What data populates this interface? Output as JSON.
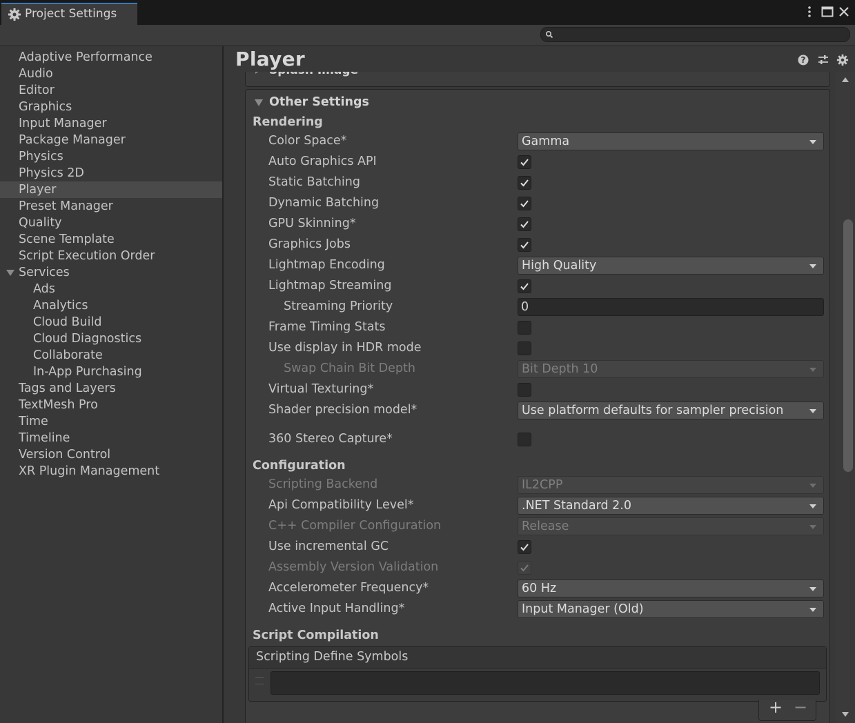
{
  "window": {
    "tab_title": "Project Settings",
    "search_placeholder": ""
  },
  "sidebar": {
    "items": [
      {
        "label": "Adaptive Performance"
      },
      {
        "label": "Audio"
      },
      {
        "label": "Editor"
      },
      {
        "label": "Graphics"
      },
      {
        "label": "Input Manager"
      },
      {
        "label": "Package Manager"
      },
      {
        "label": "Physics"
      },
      {
        "label": "Physics 2D"
      },
      {
        "label": "Player",
        "selected": true
      },
      {
        "label": "Preset Manager"
      },
      {
        "label": "Quality"
      },
      {
        "label": "Scene Template"
      },
      {
        "label": "Script Execution Order"
      },
      {
        "label": "Services",
        "expanded": true
      },
      {
        "label": "Ads",
        "child": true
      },
      {
        "label": "Analytics",
        "child": true
      },
      {
        "label": "Cloud Build",
        "child": true
      },
      {
        "label": "Cloud Diagnostics",
        "child": true
      },
      {
        "label": "Collaborate",
        "child": true
      },
      {
        "label": "In-App Purchasing",
        "child": true
      },
      {
        "label": "Tags and Layers"
      },
      {
        "label": "TextMesh Pro"
      },
      {
        "label": "Time"
      },
      {
        "label": "Timeline"
      },
      {
        "label": "Version Control"
      },
      {
        "label": "XR Plugin Management"
      }
    ]
  },
  "main": {
    "title": "Player",
    "splash_section": "Splash Image",
    "other_section": "Other Settings",
    "groups": {
      "rendering": "Rendering",
      "configuration": "Configuration",
      "script_compilation": "Script Compilation"
    },
    "rendering": {
      "color_space": {
        "label": "Color Space*",
        "value": "Gamma"
      },
      "auto_graphics_api": {
        "label": "Auto Graphics API",
        "checked": true
      },
      "static_batching": {
        "label": "Static Batching",
        "checked": true
      },
      "dynamic_batching": {
        "label": "Dynamic Batching",
        "checked": true
      },
      "gpu_skinning": {
        "label": "GPU Skinning*",
        "checked": true
      },
      "graphics_jobs": {
        "label": "Graphics Jobs",
        "checked": true
      },
      "lightmap_encoding": {
        "label": "Lightmap Encoding",
        "value": "High Quality"
      },
      "lightmap_streaming": {
        "label": "Lightmap Streaming",
        "checked": true
      },
      "streaming_priority": {
        "label": "Streaming Priority",
        "value": "0"
      },
      "frame_timing_stats": {
        "label": "Frame Timing Stats",
        "checked": false
      },
      "hdr_mode": {
        "label": "Use display in HDR mode",
        "checked": false
      },
      "swap_chain_bit_depth": {
        "label": "Swap Chain Bit Depth",
        "value": "Bit Depth 10",
        "disabled": true
      },
      "virtual_texturing": {
        "label": "Virtual Texturing*",
        "checked": false
      },
      "shader_precision": {
        "label": "Shader precision model*",
        "value": "Use platform defaults for sampler precision"
      },
      "stereo_capture": {
        "label": "360 Stereo Capture*",
        "checked": false
      }
    },
    "configuration": {
      "scripting_backend": {
        "label": "Scripting Backend",
        "value": "IL2CPP",
        "disabled": true
      },
      "api_compat": {
        "label": "Api Compatibility Level*",
        "value": ".NET Standard 2.0"
      },
      "cpp_compiler": {
        "label": "C++ Compiler Configuration",
        "value": "Release",
        "disabled": true
      },
      "incremental_gc": {
        "label": "Use incremental GC",
        "checked": true
      },
      "assembly_validation": {
        "label": "Assembly Version Validation",
        "checked": true,
        "disabled": true
      },
      "accelerometer": {
        "label": "Accelerometer Frequency*",
        "value": "60 Hz"
      },
      "input_handling": {
        "label": "Active Input Handling*",
        "value": "Input Manager (Old)"
      }
    },
    "script_compilation": {
      "define_symbols_header": "Scripting Define Symbols",
      "define_symbols_value": "",
      "add_label": "+",
      "remove_label": "−"
    }
  },
  "icons": {
    "tab": "gear-icon",
    "header": [
      "help-icon",
      "presets-icon",
      "settings-icon"
    ],
    "window": [
      "more-icon",
      "maximize-icon",
      "close-icon"
    ]
  },
  "colors": {
    "background": "#383838",
    "titlebar": "#191919",
    "selection": "#4a4a4a",
    "accent": "#3a79bb"
  }
}
